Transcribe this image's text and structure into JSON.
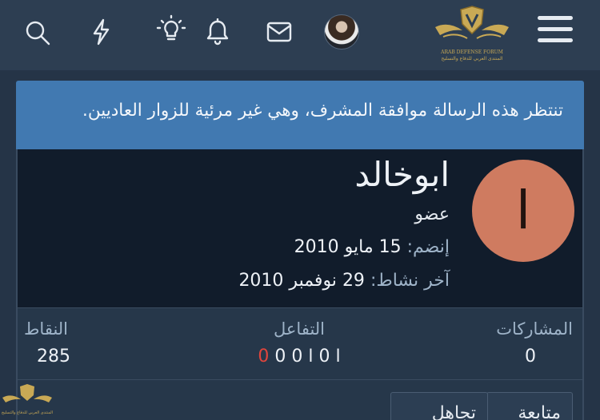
{
  "nav": {
    "icons": [
      "search-icon",
      "bolt-icon",
      "lightbulb-icon",
      "bell-icon",
      "mail-icon",
      "menu-icon"
    ],
    "logo_text": "ARAB DEFENSE FORUM",
    "logo_subtext": "المنتدى العربي للدفاع والتسليح"
  },
  "notice": {
    "text": "تنتظر هذه الرسالة موافقة المشرف، وهي غير مرئية للزوار العاديين."
  },
  "profile": {
    "avatar_letter": "ا",
    "avatar_color": "#cf7b60",
    "username": "ابوخالد",
    "role": "عضو",
    "joined_label": "إنضم:",
    "joined_value": "15 مايو 2010",
    "last_activity_label": "آخر نشاط:",
    "last_activity_value": "29 نوفمبر 2010"
  },
  "stats": {
    "posts_label": "المشاركات",
    "posts_value": "0",
    "reactions_label": "التفاعل",
    "reactions_digits": "0 ا 0 ا 0",
    "reactions_negative": "0",
    "points_label": "النقاط",
    "points_value": "285"
  },
  "actions": {
    "follow_label": "متابعة",
    "ignore_label": "تجاهل"
  },
  "colors": {
    "accent": "#4179b1",
    "negative": "#e0453c",
    "background": "#253447"
  }
}
